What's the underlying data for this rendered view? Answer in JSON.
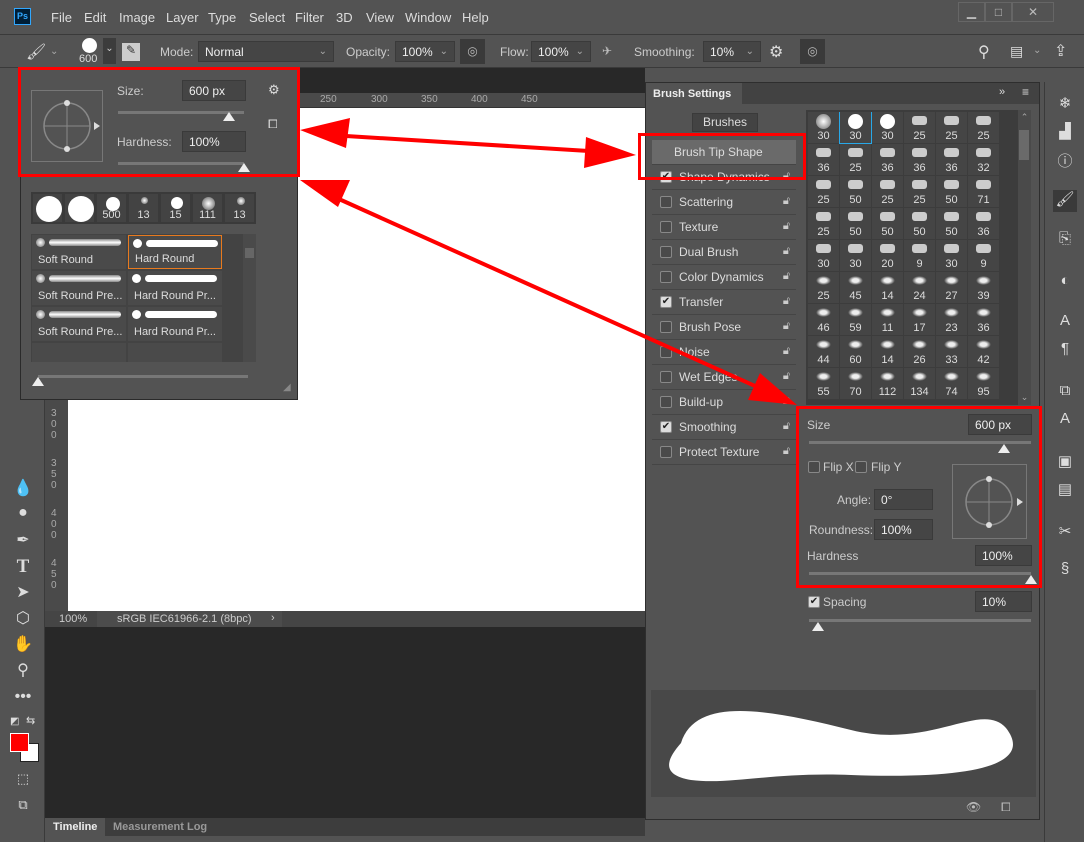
{
  "app": {
    "logo": "Ps",
    "menu": [
      "File",
      "Edit",
      "Image",
      "Layer",
      "Type",
      "Select",
      "Filter",
      "3D",
      "View",
      "Window",
      "Help"
    ],
    "window_controls": [
      "minimize",
      "maximize",
      "close"
    ]
  },
  "options": {
    "brush_size": "600",
    "mode_label": "Mode:",
    "mode_value": "Normal",
    "opacity_label": "Opacity:",
    "opacity_value": "100%",
    "flow_label": "Flow:",
    "flow_value": "100%",
    "smoothing_label": "Smoothing:",
    "smoothing_value": "10%"
  },
  "tools": [
    "brush-icon",
    "blur-drop-icon",
    "dodge-icon",
    "pen-icon",
    "type-icon",
    "path-select-icon",
    "shape-icon",
    "hand-icon",
    "zoom-icon",
    "more-icon"
  ],
  "colors": {
    "foreground": "#ff0000",
    "background": "#ffffff",
    "highlight": "#ff0000",
    "selection": "#28a8e8"
  },
  "ruler": {
    "top": [
      "250",
      "300",
      "350",
      "400",
      "450"
    ],
    "left": [
      "300",
      "350",
      "400",
      "450"
    ]
  },
  "status": {
    "zoom": "100%",
    "profile": "sRGB IEC61966-2.1 (8bpc)"
  },
  "bottom_tabs": [
    "Timeline",
    "Measurement Log"
  ],
  "preset_popup": {
    "size_label": "Size:",
    "size_value": "600 px",
    "hardness_label": "Hardness:",
    "hardness_value": "100%",
    "size_fraction": 0.88,
    "hardness_fraction": 1.0,
    "recent": [
      "",
      "",
      "500",
      "13",
      "15",
      "111",
      "13"
    ],
    "presets": [
      "Soft Round",
      "Hard Round",
      "Soft Round Pre...",
      "Hard Round Pr...",
      "Soft Round Pre...",
      "Hard Round Pr..."
    ],
    "selected": "Hard Round"
  },
  "brush_settings": {
    "title": "Brush Settings",
    "brushes_button": "Brushes",
    "options": [
      {
        "label": "Brush Tip Shape",
        "checked": null
      },
      {
        "label": "Shape Dynamics",
        "checked": true
      },
      {
        "label": "Scattering",
        "checked": false
      },
      {
        "label": "Texture",
        "checked": false
      },
      {
        "label": "Dual Brush",
        "checked": false
      },
      {
        "label": "Color Dynamics",
        "checked": false
      },
      {
        "label": "Transfer",
        "checked": true
      },
      {
        "label": "Brush Pose",
        "checked": false
      },
      {
        "label": "Noise",
        "checked": false
      },
      {
        "label": "Wet Edges",
        "checked": false
      },
      {
        "label": "Build-up",
        "checked": false
      },
      {
        "label": "Smoothing",
        "checked": true
      },
      {
        "label": "Protect Texture",
        "checked": false
      }
    ],
    "tip_sizes": [
      "30",
      "30",
      "30",
      "25",
      "25",
      "25",
      "36",
      "25",
      "36",
      "36",
      "36",
      "32",
      "25",
      "50",
      "25",
      "25",
      "50",
      "71",
      "25",
      "50",
      "50",
      "50",
      "50",
      "36",
      "30",
      "30",
      "20",
      "9",
      "30",
      "9",
      "25",
      "45",
      "14",
      "24",
      "27",
      "39",
      "46",
      "59",
      "11",
      "17",
      "23",
      "36",
      "44",
      "60",
      "14",
      "26",
      "33",
      "42",
      "55",
      "70",
      "112",
      "134",
      "74",
      "95"
    ],
    "selected_tip": 1,
    "size_label": "Size",
    "size_value": "600 px",
    "flip_x": "Flip X",
    "flip_y": "Flip Y",
    "angle_label": "Angle:",
    "angle_value": "0°",
    "roundness_label": "Roundness:",
    "roundness_value": "100%",
    "hardness_label": "Hardness",
    "hardness_value": "100%",
    "spacing_label": "Spacing",
    "spacing_value": "10%",
    "spacing_checked": true,
    "size_fraction": 0.88,
    "hardness_fraction": 1.0,
    "spacing_fraction": 0.04
  }
}
